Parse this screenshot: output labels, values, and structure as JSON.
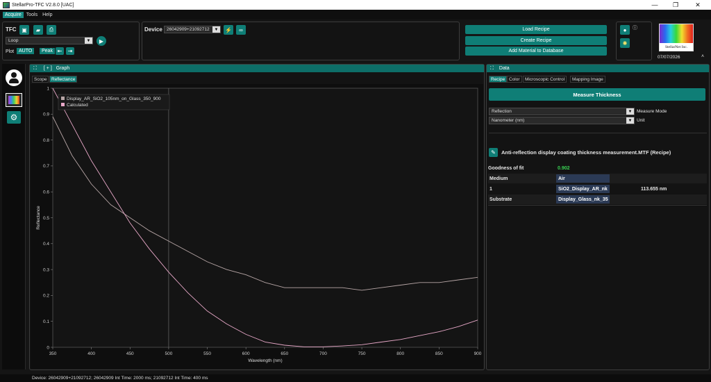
{
  "window": {
    "title": "StellarPro-TFC V2.8.0 [UAC]",
    "minimize": "—",
    "maximize": "❐",
    "close": "✕"
  },
  "menu": [
    "Acquire",
    "Tools",
    "Help"
  ],
  "tfc": {
    "label": "TFC",
    "mode_value": "Loop",
    "plot_label": "Plot",
    "auto_label": "AUTO",
    "peak_label": "Peak"
  },
  "device": {
    "label": "Device",
    "value": "26042909+21092712"
  },
  "actions": {
    "load": "Load Recipe",
    "create": "Create Recipe",
    "add_material": "Add Material to Database"
  },
  "logo": {
    "text": "StellarNet Inc.",
    "date": "07/07/2026"
  },
  "graph_panel": {
    "expand": "[ + ]",
    "title": "Graph",
    "tabs": [
      "Scope",
      "Reflectance"
    ],
    "active_tab": "Reflectance"
  },
  "data_panel": {
    "title": "Data",
    "tabs": [
      "Recipe",
      "Color",
      "Microscopic Control",
      "Mapping Image"
    ],
    "active_tab": "Recipe"
  },
  "measure_button": "Measure Thickness",
  "measure_mode": {
    "value": "Reflection",
    "label": "Measure Mode"
  },
  "unit": {
    "value": "Nanometer (nm)",
    "label": "Unit"
  },
  "recipe_name": "Anti-reflection display coating thickness measurement.MTF (Recipe)",
  "results": {
    "gof_label": "Goodness of fit",
    "gof_value": "0.902",
    "medium_label": "Medium",
    "medium_value": "Air",
    "layer_index": "1",
    "layer_material": "SiO2_Display_AR_nk",
    "layer_thickness": "113.655 nm",
    "substrate_label": "Substrate",
    "substrate_value": "Display_Glass_nk_35"
  },
  "status": {
    "text": "Device: 26042909+21092712;  26042909 Int Time: 2000 ms;  21092712 Int Time: 400 ms"
  },
  "colors": {
    "accent": "#0f7e76",
    "measured": "#b7a6a6",
    "calculated": "#e8a8c8",
    "gof": "#39d353"
  },
  "chart_data": {
    "type": "line",
    "xlabel": "Wavelength (nm)",
    "ylabel": "Reflectance",
    "xlim": [
      350,
      900
    ],
    "ylim": [
      0,
      1
    ],
    "xticks": [
      350,
      400,
      450,
      500,
      550,
      600,
      650,
      700,
      750,
      800,
      850,
      900
    ],
    "yticks": [
      0,
      0.1,
      0.2,
      0.3,
      0.4,
      0.5,
      0.6,
      0.7,
      0.8,
      0.9,
      1
    ],
    "vline_x": 500,
    "legend_position": "top-left",
    "series": [
      {
        "name": "Display_AR_SiO2_105nm_on_Glass_350_900",
        "x": [
          350,
          375,
          400,
          425,
          450,
          475,
          500,
          525,
          550,
          575,
          600,
          625,
          650,
          675,
          700,
          725,
          750,
          775,
          800,
          825,
          850,
          875,
          900
        ],
        "y": [
          0.89,
          0.74,
          0.63,
          0.55,
          0.5,
          0.45,
          0.41,
          0.37,
          0.33,
          0.3,
          0.28,
          0.25,
          0.23,
          0.23,
          0.23,
          0.23,
          0.22,
          0.23,
          0.24,
          0.25,
          0.25,
          0.26,
          0.27
        ]
      },
      {
        "name": "Calculated",
        "x": [
          350,
          375,
          400,
          425,
          450,
          475,
          500,
          525,
          550,
          575,
          600,
          625,
          650,
          675,
          700,
          725,
          750,
          775,
          800,
          825,
          850,
          875,
          900
        ],
        "y": [
          1.0,
          0.86,
          0.72,
          0.6,
          0.48,
          0.38,
          0.29,
          0.21,
          0.14,
          0.09,
          0.05,
          0.02,
          0.008,
          0.002,
          0.002,
          0.005,
          0.01,
          0.02,
          0.03,
          0.045,
          0.06,
          0.08,
          0.105
        ]
      }
    ]
  }
}
